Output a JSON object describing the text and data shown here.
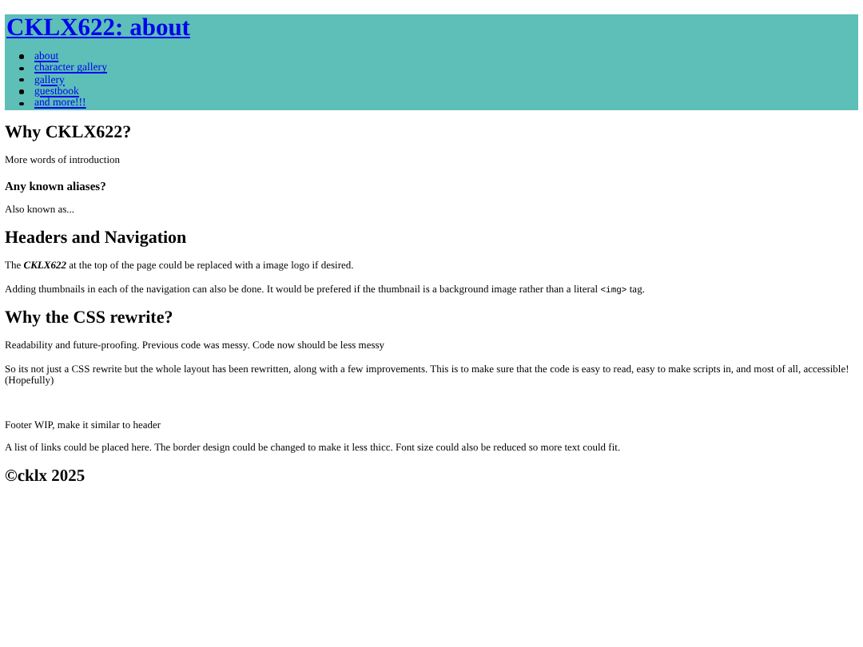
{
  "header": {
    "title": "CKLX622: about",
    "nav": [
      "about",
      "character gallery",
      "gallery",
      "guestbook",
      "and more!!!"
    ]
  },
  "sections": [
    {
      "kind": "h2",
      "parts": [
        {
          "kind": "plain",
          "text": "Why CKLX622?"
        }
      ]
    },
    {
      "kind": "p",
      "parts": [
        {
          "kind": "plain",
          "text": "More words of introduction"
        }
      ]
    },
    {
      "kind": "h3",
      "parts": [
        {
          "kind": "plain",
          "text": "Any known aliases?"
        }
      ]
    },
    {
      "kind": "p",
      "parts": [
        {
          "kind": "plain",
          "text": "Also known as..."
        }
      ]
    },
    {
      "kind": "h2",
      "parts": [
        {
          "kind": "plain",
          "text": "Headers and Navigation"
        }
      ]
    },
    {
      "kind": "p",
      "parts": [
        {
          "kind": "plain",
          "text": "The "
        },
        {
          "kind": "strong-em",
          "text": "CKLX622"
        },
        {
          "kind": "plain",
          "text": " at the top of the page could be replaced with a image logo if desired."
        }
      ]
    },
    {
      "kind": "p",
      "parts": [
        {
          "kind": "plain",
          "text": "Adding thumbnails in each of the navigation can also be done. It would be prefered if the thumbnail is a background image rather than a literal "
        },
        {
          "kind": "code",
          "text": "<img>"
        },
        {
          "kind": "plain",
          "text": " tag."
        }
      ]
    },
    {
      "kind": "h2",
      "parts": [
        {
          "kind": "plain",
          "text": "Why the CSS rewrite?"
        }
      ]
    },
    {
      "kind": "p",
      "parts": [
        {
          "kind": "plain",
          "text": "Readability and future-proofing. Previous code was messy. Code now should be less messy"
        }
      ]
    },
    {
      "kind": "p",
      "parts": [
        {
          "kind": "plain",
          "text": "So its not just a CSS rewrite but the whole layout has been rewritten, along with a few improvements. This is to make sure that the code is easy to read, easy to make scripts in, and most of all, accessible! (Hopefully)"
        }
      ]
    }
  ],
  "footer": {
    "notes": [
      "Footer WIP, make it similar to header",
      "A list of links could be placed here. The border design could be changed to make it less thicc. Font size could also be reduced so more text could fit."
    ],
    "copyright": "©cklx 2025"
  }
}
